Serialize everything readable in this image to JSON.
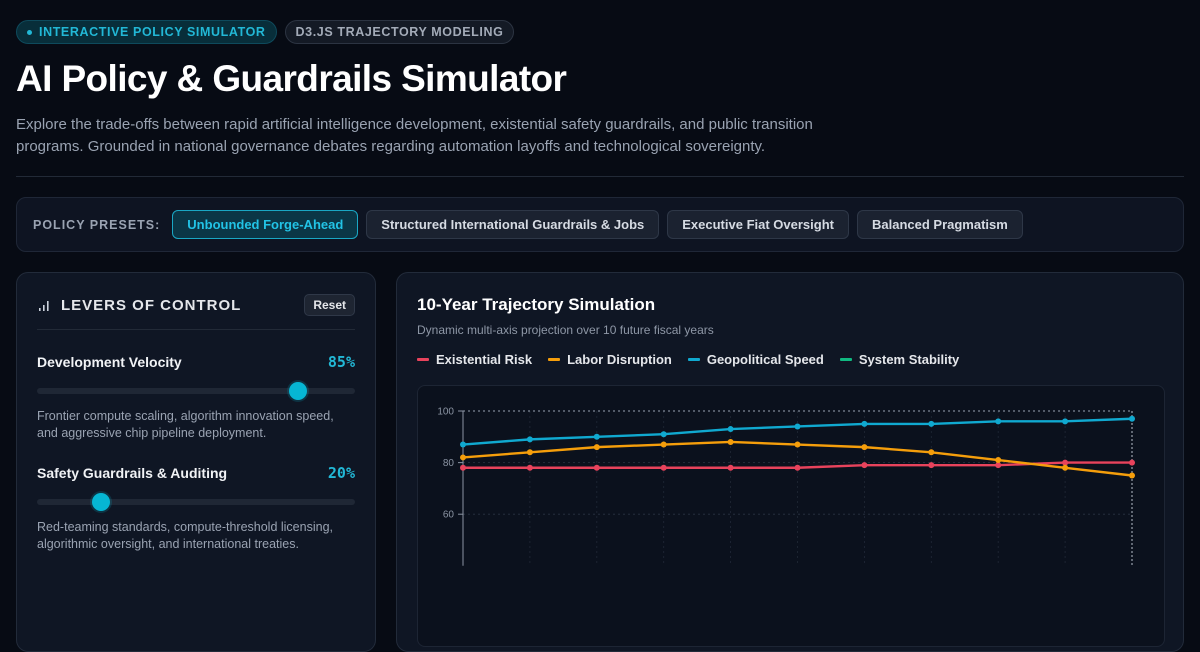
{
  "badges": {
    "primary": "INTERACTIVE POLICY SIMULATOR",
    "secondary": "D3.JS TRAJECTORY MODELING"
  },
  "page": {
    "title": "AI Policy & Guardrails Simulator",
    "description": "Explore the trade-offs between rapid artificial intelligence development, existential safety guardrails, and public transition programs. Grounded in national governance debates regarding automation layoffs and technological sovereignty."
  },
  "presets": {
    "label": "POLICY PRESETS:",
    "items": [
      {
        "label": "Unbounded Forge-Ahead",
        "active": true
      },
      {
        "label": "Structured International Guardrails & Jobs",
        "active": false
      },
      {
        "label": "Executive Fiat Oversight",
        "active": false
      },
      {
        "label": "Balanced Pragmatism",
        "active": false
      }
    ]
  },
  "levers": {
    "title": "LEVERS OF CONTROL",
    "reset_label": "Reset",
    "items": [
      {
        "name": "Development Velocity",
        "value_label": "85%",
        "value": 0.82,
        "description": "Frontier compute scaling, algorithm innovation speed, and aggressive chip pipeline deployment."
      },
      {
        "name": "Safety Guardrails & Auditing",
        "value_label": "20%",
        "value": 0.2,
        "description": "Red-teaming standards, compute-threshold licensing, algorithmic oversight, and international treaties."
      }
    ]
  },
  "chart": {
    "title": "10-Year Trajectory Simulation",
    "subtitle": "Dynamic multi-axis projection over 10 future fiscal years",
    "colors": {
      "background": "#0b111d",
      "grid": "#2a3342",
      "axis": "#8b94a3",
      "tick_text": "#8b94a3"
    }
  },
  "chart_data": {
    "type": "line",
    "x": [
      0,
      1,
      2,
      3,
      4,
      5,
      6,
      7,
      8,
      9,
      10
    ],
    "ylim": [
      40,
      100
    ],
    "yticks": [
      100,
      80,
      60
    ],
    "ytick_labels": [
      "100",
      "80",
      "60"
    ],
    "xlabel": "",
    "ylabel": "",
    "grid": true,
    "legend_position": "top-left",
    "series": [
      {
        "name": "Existential Risk",
        "color": "#e8435c",
        "values": [
          78,
          78,
          78,
          78,
          78,
          78,
          79,
          79,
          79,
          80,
          80
        ]
      },
      {
        "name": "Labor Disruption",
        "color": "#f59e0b",
        "values": [
          82,
          84,
          86,
          87,
          88,
          87,
          86,
          84,
          81,
          78,
          75
        ]
      },
      {
        "name": "Geopolitical Speed",
        "color": "#10a9d0",
        "values": [
          87,
          89,
          90,
          91,
          93,
          94,
          95,
          95,
          96,
          96,
          97
        ]
      },
      {
        "name": "System Stability",
        "color": "#10b981",
        "values": []
      }
    ]
  }
}
